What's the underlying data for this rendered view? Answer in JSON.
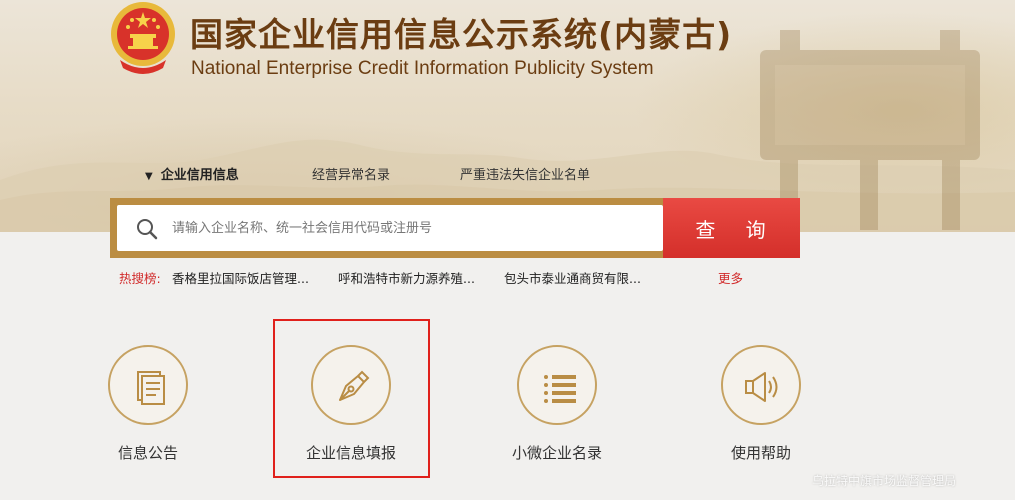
{
  "header": {
    "title_cn": "国家企业信用信息公示系统(内蒙古)",
    "title_en": "National Enterprise Credit Information Publicity System",
    "emblem": "national-emblem"
  },
  "tabs": [
    {
      "label": "企业信用信息",
      "active": true
    },
    {
      "label": "经营异常名录",
      "active": false
    },
    {
      "label": "严重违法失信企业名单",
      "active": false
    }
  ],
  "search": {
    "placeholder": "请输入企业名称、统一社会信用代码或注册号",
    "button_label": "查 询"
  },
  "hot_search": {
    "label": "热搜榜:",
    "items": [
      "香格里拉国际饭店管理...",
      "呼和浩特市新力源养殖...",
      "包头市泰业通商贸有限..."
    ],
    "more": "更多"
  },
  "features": [
    {
      "label": "信息公告",
      "icon": "document-icon"
    },
    {
      "label": "企业信息填报",
      "icon": "pen-nib-icon",
      "highlighted": true
    },
    {
      "label": "小微企业名录",
      "icon": "list-icon"
    },
    {
      "label": "使用帮助",
      "icon": "speaker-icon"
    }
  ],
  "watermark": "乌拉特中旗市场监督管理局",
  "colors": {
    "brand_brown": "#6b3d12",
    "gold": "#bb8d42",
    "search_red": "#d42f2a",
    "highlight_red": "#e0201b",
    "circle_border": "#c6a262"
  }
}
